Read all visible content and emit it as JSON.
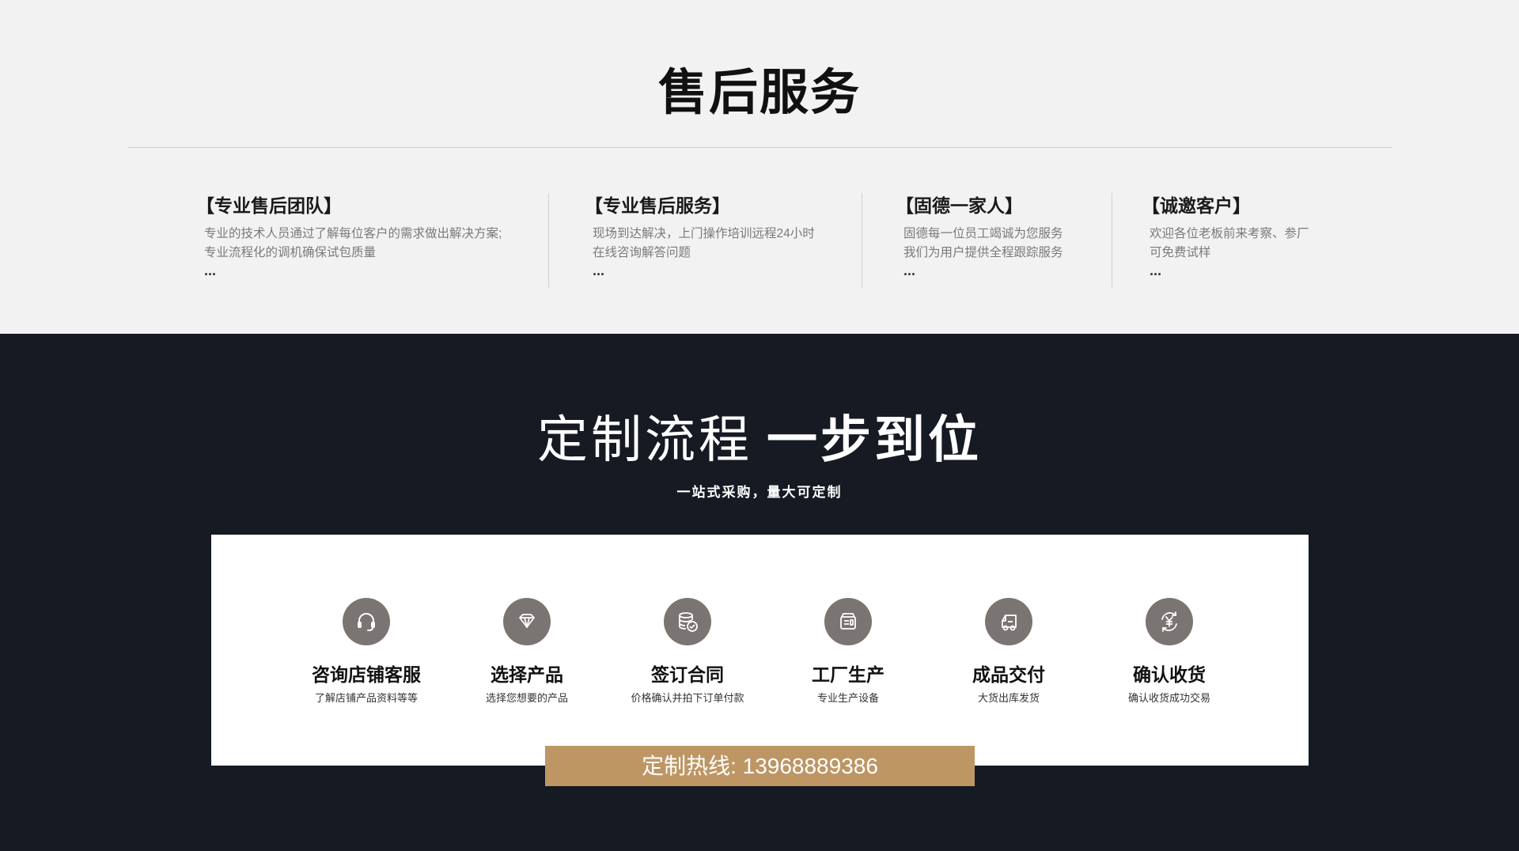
{
  "aftersales": {
    "title": "售后服务",
    "columns": [
      {
        "title": "【专业售后团队】",
        "lines": [
          "专业的技术人员通过了解每位客户的需求做出解决方案;",
          "专业流程化的调机确保试包质量"
        ],
        "more": "..."
      },
      {
        "title": "【专业售后服务】",
        "lines": [
          "现场到达解决，上门操作培训远程24小时",
          "在线咨询解答问题"
        ],
        "more": "..."
      },
      {
        "title": "【固德一家人】",
        "lines": [
          "固德每一位员工竭诚为您服务",
          "我们为用户提供全程跟踪服务"
        ],
        "more": "..."
      },
      {
        "title": "【诚邀客户】",
        "lines": [
          "欢迎各位老板前来考察、参厂",
          "可免费试样"
        ],
        "more": "..."
      }
    ]
  },
  "process": {
    "title_thin": "定制流程",
    "title_bold": "一步到位",
    "subtitle": "一站式采购，量大可定制",
    "steps": [
      {
        "icon": "headset-icon",
        "title": "咨询店铺客服",
        "desc": "了解店铺产品资料等等"
      },
      {
        "icon": "diamond-icon",
        "title": "选择产品",
        "desc": "选择您想要的产品"
      },
      {
        "icon": "database-check-icon",
        "title": "签订合同",
        "desc": "价格确认并拍下订单付款"
      },
      {
        "icon": "machine-icon",
        "title": "工厂生产",
        "desc": "专业生产设备"
      },
      {
        "icon": "truck-icon",
        "title": "成品交付",
        "desc": "大货出库发货"
      },
      {
        "icon": "yen-refresh-icon",
        "title": "确认收货",
        "desc": "确认收货成功交易"
      }
    ],
    "hotline": "定制热线:  13968889386"
  },
  "colors": {
    "top_background": "#f2f2f2",
    "dark_background": "#151a23",
    "icon_circle": "#7a7472",
    "hotline_bar": "#bd9664"
  }
}
